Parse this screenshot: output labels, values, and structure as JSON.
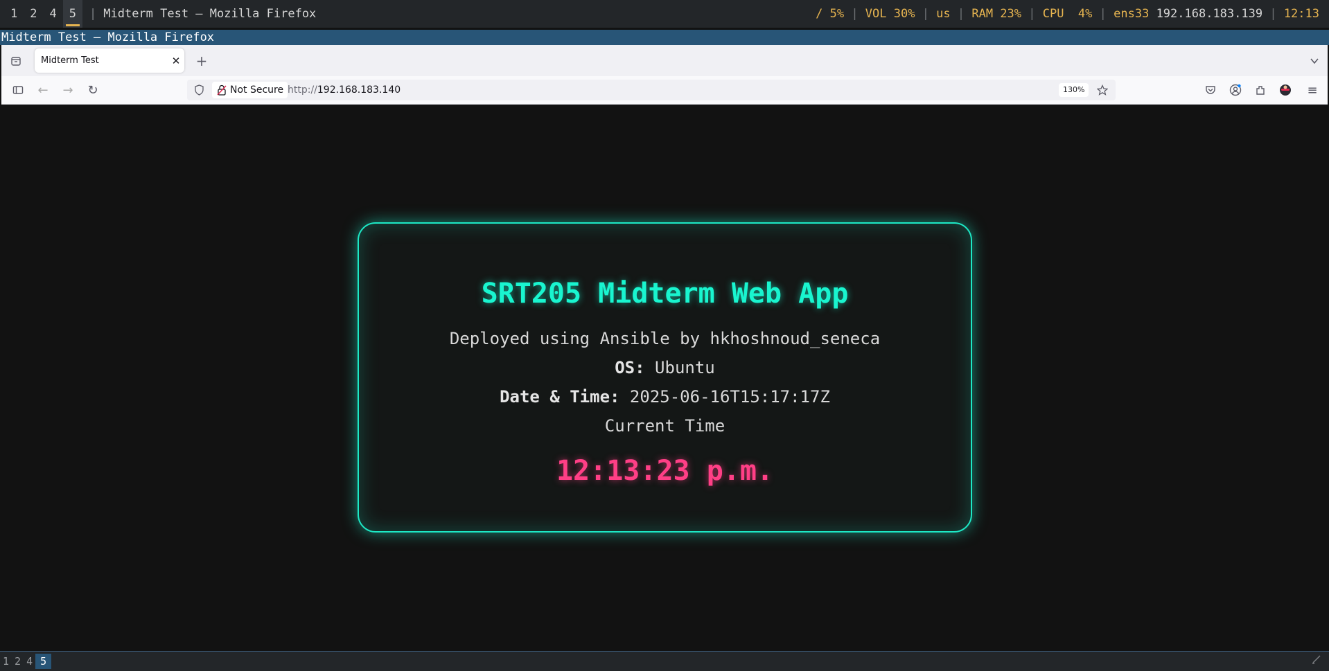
{
  "topbar": {
    "workspaces": [
      "1",
      "2",
      "4",
      "5"
    ],
    "active_workspace": "5",
    "window_title": "Midterm Test — Mozilla Firefox",
    "disk": "/ 5%",
    "volume": "VOL 30%",
    "layout": "us",
    "ram": "RAM 23%",
    "cpu": "CPU  4%",
    "net_iface": "ens33",
    "net_ip": "192.168.183.139",
    "clock": "12:13"
  },
  "i3_title": "Midterm Test — Mozilla Firefox",
  "browser": {
    "tab_title": "Midterm Test",
    "not_secure_label": "Not Secure",
    "url_protocol": "http://",
    "url_host": "192.168.183.140",
    "zoom": "130%"
  },
  "page": {
    "heading": "SRT205 Midterm Web App",
    "deployed_text": "Deployed using Ansible by hkhoshnoud_seneca",
    "os_label": "OS:",
    "os_value": "Ubuntu",
    "datetime_label": "Date & Time:",
    "datetime_value": "2025-06-16T15:17:17Z",
    "current_time_label": "Current Time",
    "current_time_value": "12:13:23 p.m."
  },
  "bottombar": {
    "workspaces": [
      "1",
      "2",
      "4",
      "5"
    ],
    "active_workspace": "5"
  },
  "colors": {
    "accent_teal": "#19f5cf",
    "clock_pink": "#ff3f86",
    "i3_focus": "#285577"
  }
}
